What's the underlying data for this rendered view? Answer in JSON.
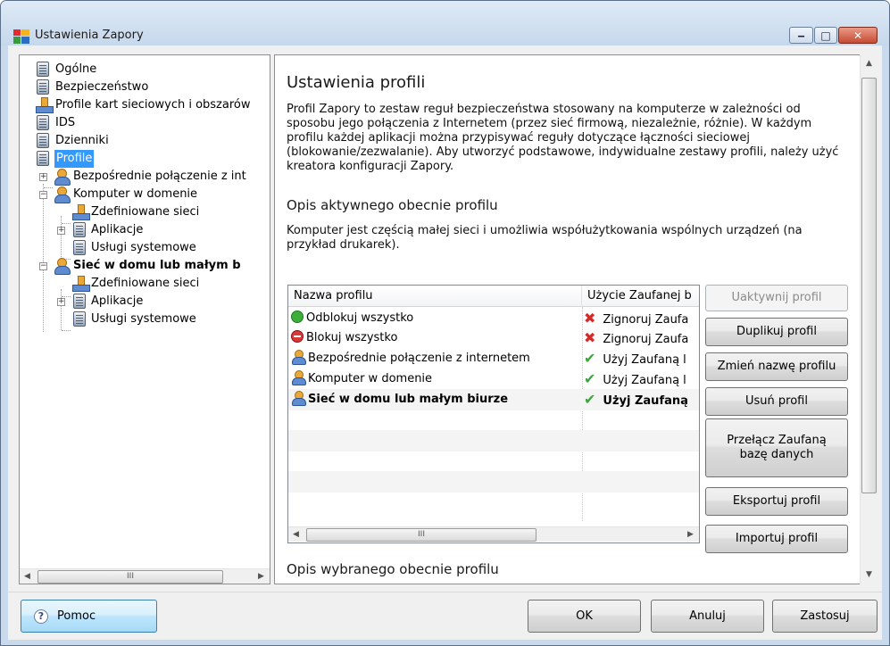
{
  "window": {
    "title": "Ustawienia Zapory",
    "controls": {
      "minimize": "‒",
      "maximize": "□",
      "close": "✕"
    }
  },
  "tree": {
    "items": [
      {
        "label": "Ogólne",
        "icon": "doc-icon"
      },
      {
        "label": "Bezpieczeństwo",
        "icon": "doc-icon"
      },
      {
        "label": "Profile kart sieciowych i obszarów",
        "icon": "network-icon"
      },
      {
        "label": "IDS",
        "icon": "doc-icon"
      },
      {
        "label": "Dzienniki",
        "icon": "doc-icon"
      },
      {
        "label": "Profile",
        "icon": "doc-icon",
        "selected": true
      },
      {
        "label": "Bezpośrednie połączenie z int",
        "icon": "user-icon",
        "expander": "+"
      },
      {
        "label": "Komputer w domenie",
        "icon": "user-icon",
        "expander": "−"
      },
      {
        "label": "Zdefiniowane sieci",
        "icon": "network-icon"
      },
      {
        "label": "Aplikacje",
        "icon": "doc-icon",
        "expander": "+"
      },
      {
        "label": "Usługi systemowe",
        "icon": "doc-icon"
      },
      {
        "label": "Sieć w domu lub małym b",
        "icon": "user-icon",
        "expander": "−",
        "bold": true
      },
      {
        "label": "Zdefiniowane sieci",
        "icon": "network-icon"
      },
      {
        "label": "Aplikacje",
        "icon": "doc-icon",
        "expander": "+"
      },
      {
        "label": "Usługi systemowe",
        "icon": "doc-icon"
      }
    ],
    "scroll_thumb": "III"
  },
  "content": {
    "title": "Ustawienia profili",
    "intro": "Profil Zapory to zestaw reguł bezpieczeństwa stosowany na komputerze w zależności od sposobu jego połączenia z Internetem (przez sieć firmową, niezależnie, różnie). W każdym profilu każdej aplikacji można przypisywać reguły dotyczące łączności sieciowej (blokowanie/zezwalanie). Aby utworzyć podstawowe, indywidualne zestawy profili, należy użyć kreatora konfiguracji Zapory.",
    "active_heading": "Opis aktywnego obecnie profilu",
    "active_desc": "Komputer jest częścią małej sieci i umożliwia współużytkowania wspólnych urządzeń (na przykład drukarek).",
    "selected_heading": "Opis wybranego obecnie profilu"
  },
  "profiles_table": {
    "columns": [
      "Nazwa profilu",
      "Użycie Zaufanej b"
    ],
    "rows": [
      {
        "name": "Odblokuj wszystko",
        "icon": "green-unlock-icon",
        "status_icon": "x-icon",
        "trusted": "Zignoruj Zaufa"
      },
      {
        "name": "Blokuj wszystko",
        "icon": "red-block-icon",
        "status_icon": "x-icon",
        "trusted": "Zignoruj Zaufa"
      },
      {
        "name": "Bezpośrednie połączenie z internetem",
        "icon": "user-icon",
        "status_icon": "check-icon",
        "trusted": "Użyj Zaufaną l"
      },
      {
        "name": "Komputer w domenie",
        "icon": "user-icon",
        "status_icon": "check-icon",
        "trusted": "Użyj Zaufaną l"
      },
      {
        "name": "Sieć w domu lub małym biurze",
        "icon": "user-icon",
        "status_icon": "check-icon",
        "trusted": "Użyj Zaufaną",
        "bold": true
      }
    ],
    "scroll_thumb": "III"
  },
  "side_buttons": {
    "activate": "Uaktywnij profil",
    "duplicate": "Duplikuj profil",
    "rename": "Zmień nazwę profilu",
    "delete": "Usuń profil",
    "switch_db": "Przełącz Zaufaną bazę danych",
    "export": "Eksportuj profil",
    "import": "Importuj profil"
  },
  "footer": {
    "help": "Pomoc",
    "ok": "OK",
    "cancel": "Anuluj",
    "apply": "Zastosuj"
  },
  "colors": {
    "selection": "#3399ff",
    "title_bar": "#c6d8ec",
    "check": "#3da53d",
    "cross": "#d42a2a"
  }
}
